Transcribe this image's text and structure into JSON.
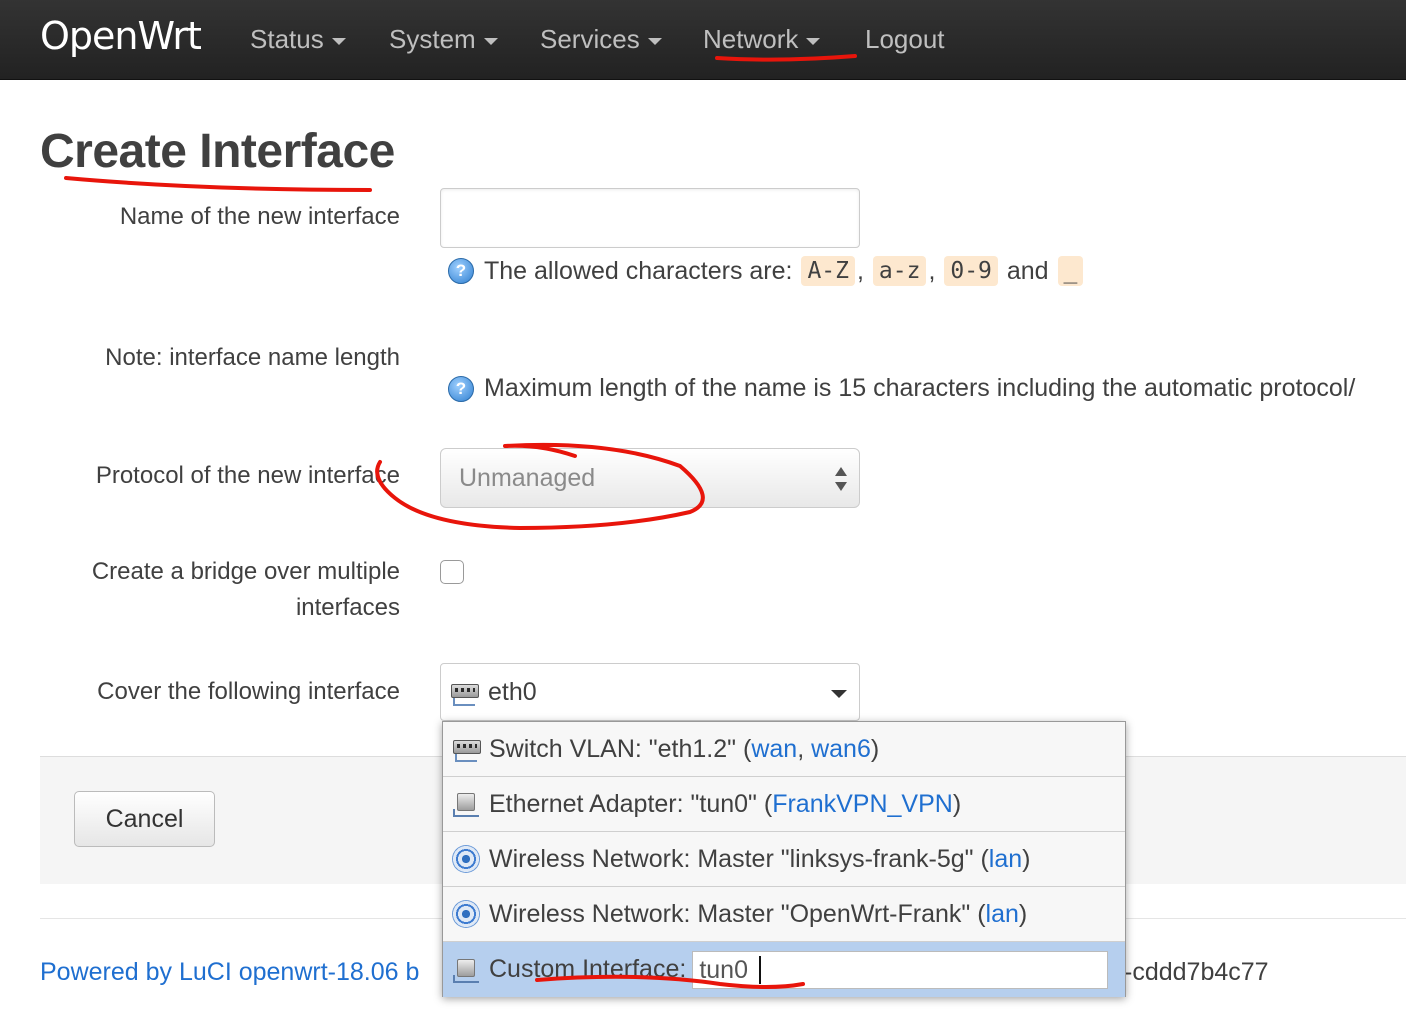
{
  "nav": {
    "brand": "OpenWrt",
    "items": [
      {
        "label": "Status"
      },
      {
        "label": "System"
      },
      {
        "label": "Services"
      },
      {
        "label": "Network"
      },
      {
        "label": "Logout"
      }
    ]
  },
  "page": {
    "title": "Create Interface"
  },
  "form": {
    "name_label": "Name of the new interface",
    "name_value": "",
    "name_help_prefix": "The allowed characters are:",
    "name_help_codes": [
      "A-Z",
      "a-z",
      "0-9",
      "_"
    ],
    "name_help_and": "and",
    "note_label": "Note: interface name length",
    "note_help": "Maximum length of the name is 15 characters including the automatic protocol/",
    "protocol_label": "Protocol of the new interface",
    "protocol_value": "Unmanaged",
    "bridge_label_line1": "Create a bridge over multiple",
    "bridge_label_line2": "interfaces",
    "bridge_checked": false,
    "cover_label": "Cover the following interface",
    "cover_value": "eth0"
  },
  "dropdown": {
    "items": [
      {
        "icon": "switch-icon",
        "text": "Switch VLAN: \"eth1.2\" (",
        "links": [
          "wan",
          "wan6"
        ],
        "suffix": ")"
      },
      {
        "icon": "ethernet-icon",
        "text": "Ethernet Adapter: \"tun0\" (",
        "links": [
          "FrankVPN_VPN"
        ],
        "suffix": ")"
      },
      {
        "icon": "wireless-icon",
        "text": "Wireless Network: Master \"linksys-frank-5g\" (",
        "links": [
          "lan"
        ],
        "suffix": ")"
      },
      {
        "icon": "wireless-icon",
        "text": "Wireless Network: Master \"OpenWrt-Frank\" (",
        "links": [
          "lan"
        ],
        "suffix": ")"
      }
    ],
    "custom_label": "Custom Interface:",
    "custom_value": "tun0"
  },
  "actions": {
    "cancel_label": "Cancel"
  },
  "footer": {
    "powered_by": "Powered by LuCI openwrt-18.06 b",
    "tail": "-cddd7b4c77"
  },
  "colors": {
    "annotation": "#e8150b",
    "link": "#1f6fd0",
    "code_bg": "#fde8cf"
  }
}
